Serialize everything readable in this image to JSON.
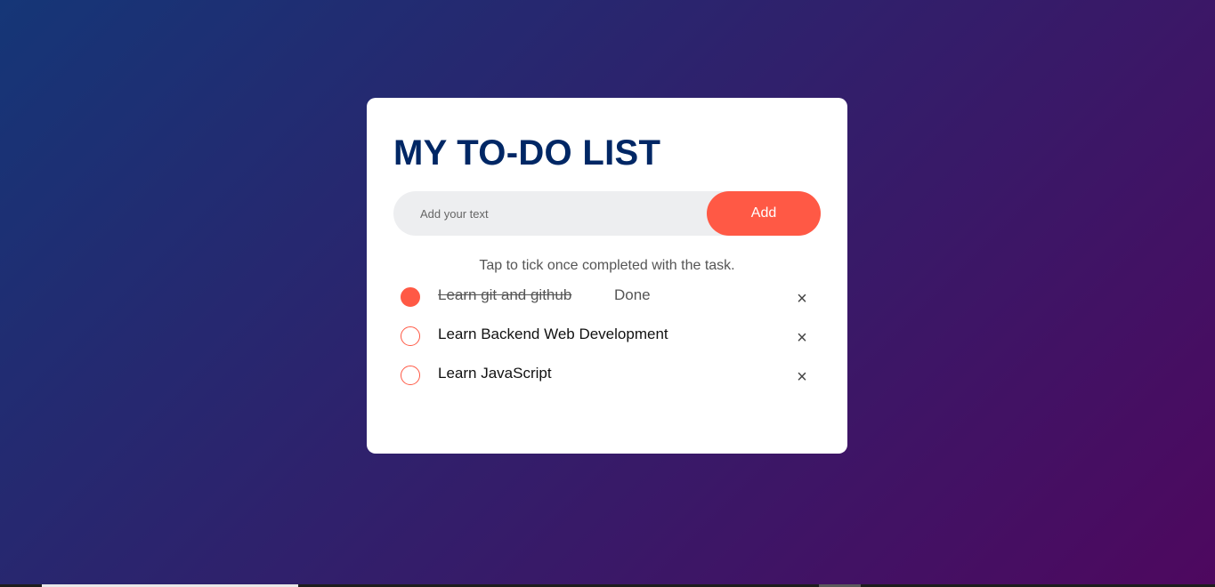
{
  "app": {
    "title": "MY TO-DO LIST"
  },
  "input": {
    "placeholder": "Add your text",
    "value": ""
  },
  "add_button": {
    "label": "Add"
  },
  "hint": "Tap to tick once completed with the task.",
  "tasks": [
    {
      "text": "Learn git and github",
      "checked": true,
      "status": "Done",
      "remove": "×"
    },
    {
      "text": "Learn Backend Web Development",
      "checked": false,
      "remove": "×"
    },
    {
      "text": "Learn JavaScript",
      "checked": false,
      "remove": "×"
    }
  ],
  "colors": {
    "accent": "#ff5945",
    "title": "#002765",
    "gradient_start": "#153677",
    "gradient_end": "#4e085f"
  }
}
